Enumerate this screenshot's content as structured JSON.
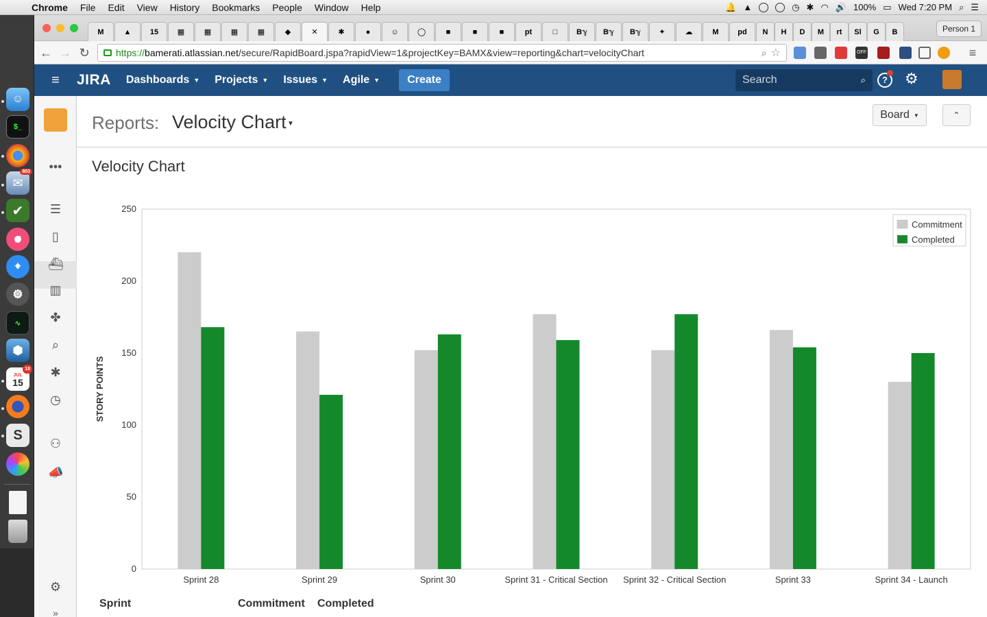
{
  "menubar": {
    "app": "Chrome",
    "items": [
      "File",
      "Edit",
      "View",
      "History",
      "Bookmarks",
      "People",
      "Window",
      "Help"
    ],
    "battery": "100%",
    "clock": "Wed 7:20 PM"
  },
  "dock": {
    "mail_badge": "803",
    "calendar_month": "JUL",
    "calendar_day": "15",
    "calendar_badge": "18"
  },
  "browser": {
    "tabs": [
      "M",
      "▲",
      "15",
      "▦",
      "▦",
      "▦",
      "▦",
      "◆",
      "✕",
      "✱",
      "●",
      "☺",
      "◯",
      "■",
      "■",
      "■",
      "pt",
      "□",
      "Bℽ",
      "Bℽ",
      "Bℽ",
      "✦",
      "☁",
      "M",
      "pd",
      "N",
      "H",
      "D",
      "M",
      "rt",
      "Sl",
      "G",
      "B"
    ],
    "person": "Person 1",
    "url_scheme": "https://",
    "url_host": "bamerati.atlassian.net",
    "url_path": "/secure/RapidBoard.jspa?rapidView=1&projectKey=BAMX&view=reporting&chart=velocityChart",
    "ext_badges": [
      "2",
      "45",
      "2",
      "OFF",
      "2"
    ]
  },
  "jira": {
    "logo": "JIRA",
    "nav": [
      "Dashboards",
      "Projects",
      "Issues",
      "Agile"
    ],
    "create": "Create",
    "search_placeholder": "Search"
  },
  "page": {
    "reports_label": "Reports:",
    "report_name": "Velocity Chart",
    "board_button": "Board",
    "chart_title": "Velocity Chart",
    "table_headers": [
      "Sprint",
      "Commitment",
      "Completed"
    ]
  },
  "colors": {
    "commitment": "#cccccc",
    "completed": "#14892c",
    "header": "#205081"
  },
  "chart_data": {
    "type": "bar",
    "title": "Velocity Chart",
    "xlabel": "",
    "ylabel": "STORY POINTS",
    "ylim": [
      0,
      250
    ],
    "yticks": [
      0,
      50,
      100,
      150,
      200,
      250
    ],
    "categories": [
      "Sprint 28",
      "Sprint 29",
      "Sprint 30",
      "Sprint 31 - Critical Section",
      "Sprint 32 - Critical Section",
      "Sprint 33",
      "Sprint 34 - Launch"
    ],
    "series": [
      {
        "name": "Commitment",
        "color": "#cccccc",
        "values": [
          220,
          165,
          152,
          177,
          152,
          166,
          130
        ]
      },
      {
        "name": "Completed",
        "color": "#14892c",
        "values": [
          168,
          121,
          163,
          159,
          177,
          154,
          150
        ]
      }
    ],
    "legend": "top-right",
    "grid": false
  }
}
